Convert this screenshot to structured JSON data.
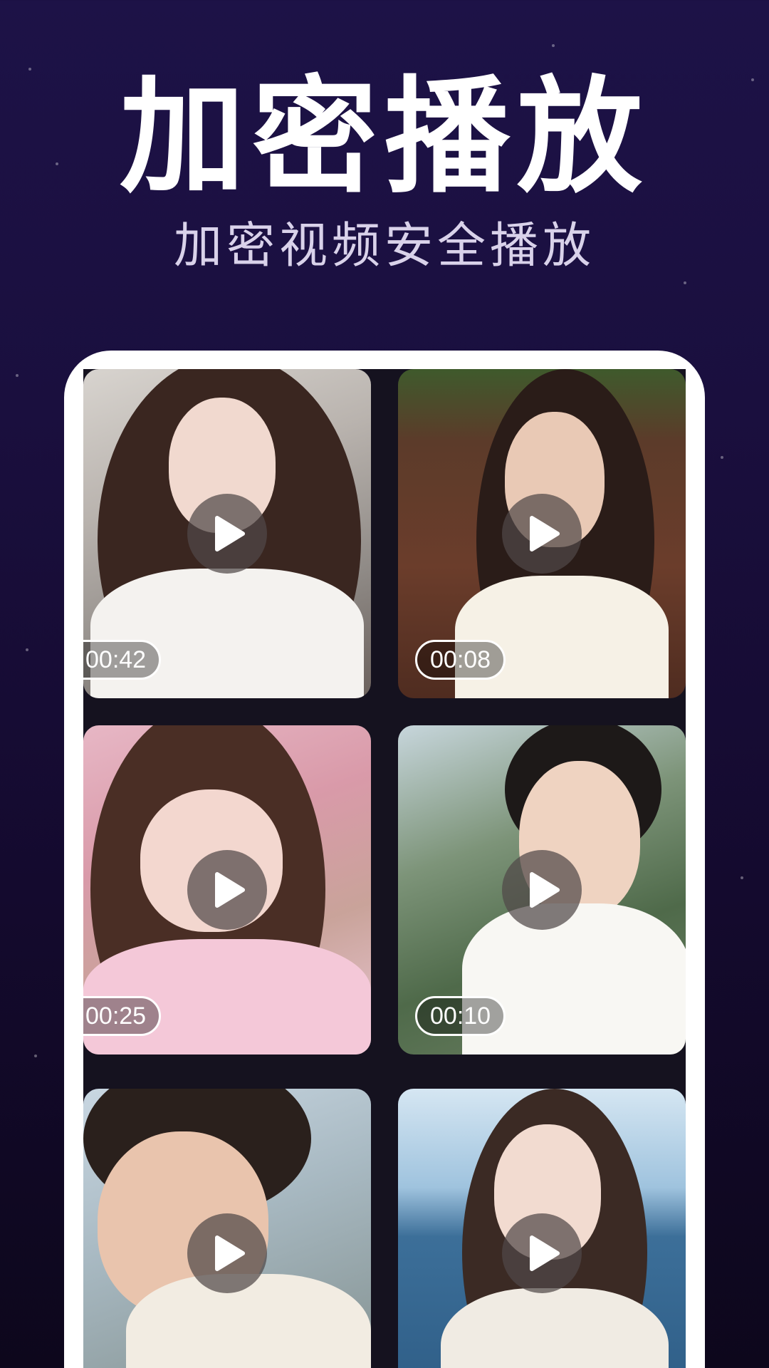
{
  "headline": "加密播放",
  "subheadline": "加密视频安全播放",
  "colors": {
    "background_top": "#1d1247",
    "background_bottom": "#0d071c",
    "phone_frame": "#ffffff",
    "screen_bg": "#15121f",
    "headline": "#ffffff",
    "subheadline": "#d9d2ea"
  },
  "videos": [
    {
      "duration": "00:42",
      "icon": "play-icon"
    },
    {
      "duration": "00:08",
      "icon": "play-icon"
    },
    {
      "duration": "00:25",
      "icon": "play-icon"
    },
    {
      "duration": "00:10",
      "icon": "play-icon"
    },
    {
      "duration": "",
      "icon": "play-icon"
    },
    {
      "duration": "",
      "icon": "play-icon"
    }
  ]
}
